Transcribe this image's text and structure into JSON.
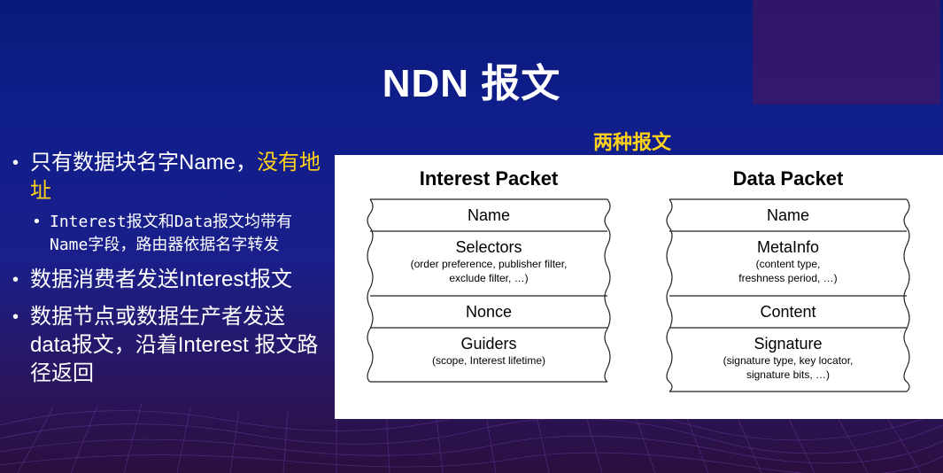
{
  "slide": {
    "title": "NDN 报文"
  },
  "bullets": {
    "b1_main": "只有数据块名字Name，",
    "b1_highlight": "没有地址",
    "b1_sub": "Interest报文和Data报文均带有Name字段，路由器依据名字转发",
    "b2": "数据消费者发送Interest报文",
    "b3": "数据节点或数据生产者发送data报文，沿着Interest 报文路径返回"
  },
  "diagram": {
    "caption": "两种报文",
    "interest": {
      "title": "Interest Packet",
      "fields": [
        {
          "name": "Name",
          "desc": ""
        },
        {
          "name": "Selectors",
          "desc": "(order preference, publisher filter,\nexclude filter, …)"
        },
        {
          "name": "Nonce",
          "desc": ""
        },
        {
          "name": "Guiders",
          "desc": "(scope, Interest lifetime)"
        }
      ]
    },
    "data": {
      "title": "Data Packet",
      "fields": [
        {
          "name": "Name",
          "desc": ""
        },
        {
          "name": "MetaInfo",
          "desc": "(content type,\nfreshness period, …)"
        },
        {
          "name": "Content",
          "desc": ""
        },
        {
          "name": "Signature",
          "desc": "(signature type, key locator,\nsignature bits, …)"
        }
      ]
    }
  },
  "colors": {
    "highlight": "#ffd21a",
    "background_top": "#0a1a7a",
    "background_bottom": "#2a0f3e"
  }
}
